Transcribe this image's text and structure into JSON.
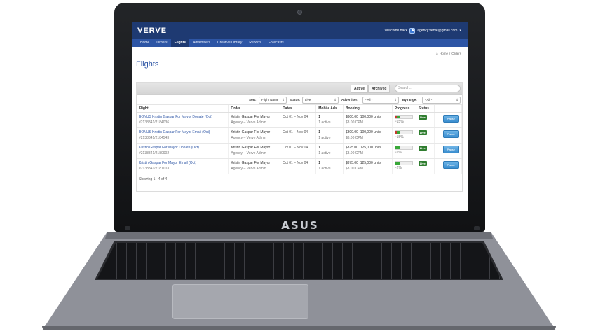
{
  "laptop": {
    "brand": "ASUS"
  },
  "app": {
    "logo": "VERVE",
    "welcome": "Welcome back",
    "user_email": "agency.verve@gmail.com",
    "nav": [
      {
        "label": "Home"
      },
      {
        "label": "Orders"
      },
      {
        "label": "Flights",
        "active": true
      },
      {
        "label": "Advertisers"
      },
      {
        "label": "Creative Library"
      },
      {
        "label": "Reports"
      },
      {
        "label": "Forecasts"
      }
    ],
    "breadcrumb": {
      "home": "Home",
      "separator": "/",
      "current": "Orders"
    },
    "page_title": "Flights",
    "tabs": {
      "active": "Active",
      "archived": "Archived"
    },
    "search": {
      "placeholder": "Search..."
    },
    "filters": {
      "sort_label": "Sort:",
      "sort_value": "Flight Name",
      "status_label": "Status:",
      "status_value": "Live",
      "advertiser_label": "Advertiser:",
      "advertiser_value": "- All -",
      "range_label": "By range:",
      "range_value": "- All -"
    },
    "columns": [
      "Flight",
      "Order",
      "Dates",
      "Mobile Ads",
      "Booking",
      "Progress",
      "Status"
    ],
    "rows": [
      {
        "name": "BONUS Kristin Gaspar For Mayor Donate (Oct)",
        "id": "#2138841/2184036",
        "order": "Kristin Gaspar For Mayor",
        "agency": "Agency – Verve Admin",
        "dates": "Oct 01 – Nov 04",
        "ads": "1",
        "ads_active": "1 active",
        "booking": "$300.00",
        "units": "100,000 units",
        "cpm": "$3.00 CPM",
        "progress": 0.15,
        "progress_label": "~15%",
        "status": "Live",
        "action": "Pause"
      },
      {
        "name": "BONUS Kristin Gaspar For Mayor Email (Oct)",
        "id": "#2138841/2184543",
        "order": "Kristin Gaspar For Mayor",
        "agency": "Agency – Verve Admin",
        "dates": "Oct 01 – Nov 04",
        "ads": "1",
        "ads_active": "1 active",
        "booking": "$300.00",
        "units": "100,000 units",
        "cpm": "$3.00 CPM",
        "progress": 0.15,
        "progress_label": "~15%",
        "status": "Live",
        "action": "Pause"
      },
      {
        "name": "Kristin Gaspar For Mayor Donate (Oct)",
        "id": "#2138841/2180902",
        "order": "Kristin Gaspar For Mayor",
        "agency": "Agency – Verve Admin",
        "dates": "Oct 01 – Nov 04",
        "ads": "1",
        "ads_active": "1 active",
        "booking": "$375.00",
        "units": "125,000 units",
        "cpm": "$3.00 CPM",
        "progress": 0.01,
        "progress_label": "~1%",
        "status": "Live",
        "action": "Pause"
      },
      {
        "name": "Kristin Gaspar For Mayor Email (Oct)",
        "id": "#2138841/2181003",
        "order": "Kristin Gaspar For Mayor",
        "agency": "Agency – Verve Admin",
        "dates": "Oct 01 – Nov 04",
        "ads": "1",
        "ads_active": "1 active",
        "booking": "$375.00",
        "units": "125,000 units",
        "cpm": "$3.00 CPM",
        "progress": 0.02,
        "progress_label": "~2%",
        "status": "Live",
        "action": "Pause"
      }
    ],
    "showing": "Showing 1 - 4 of 4"
  }
}
